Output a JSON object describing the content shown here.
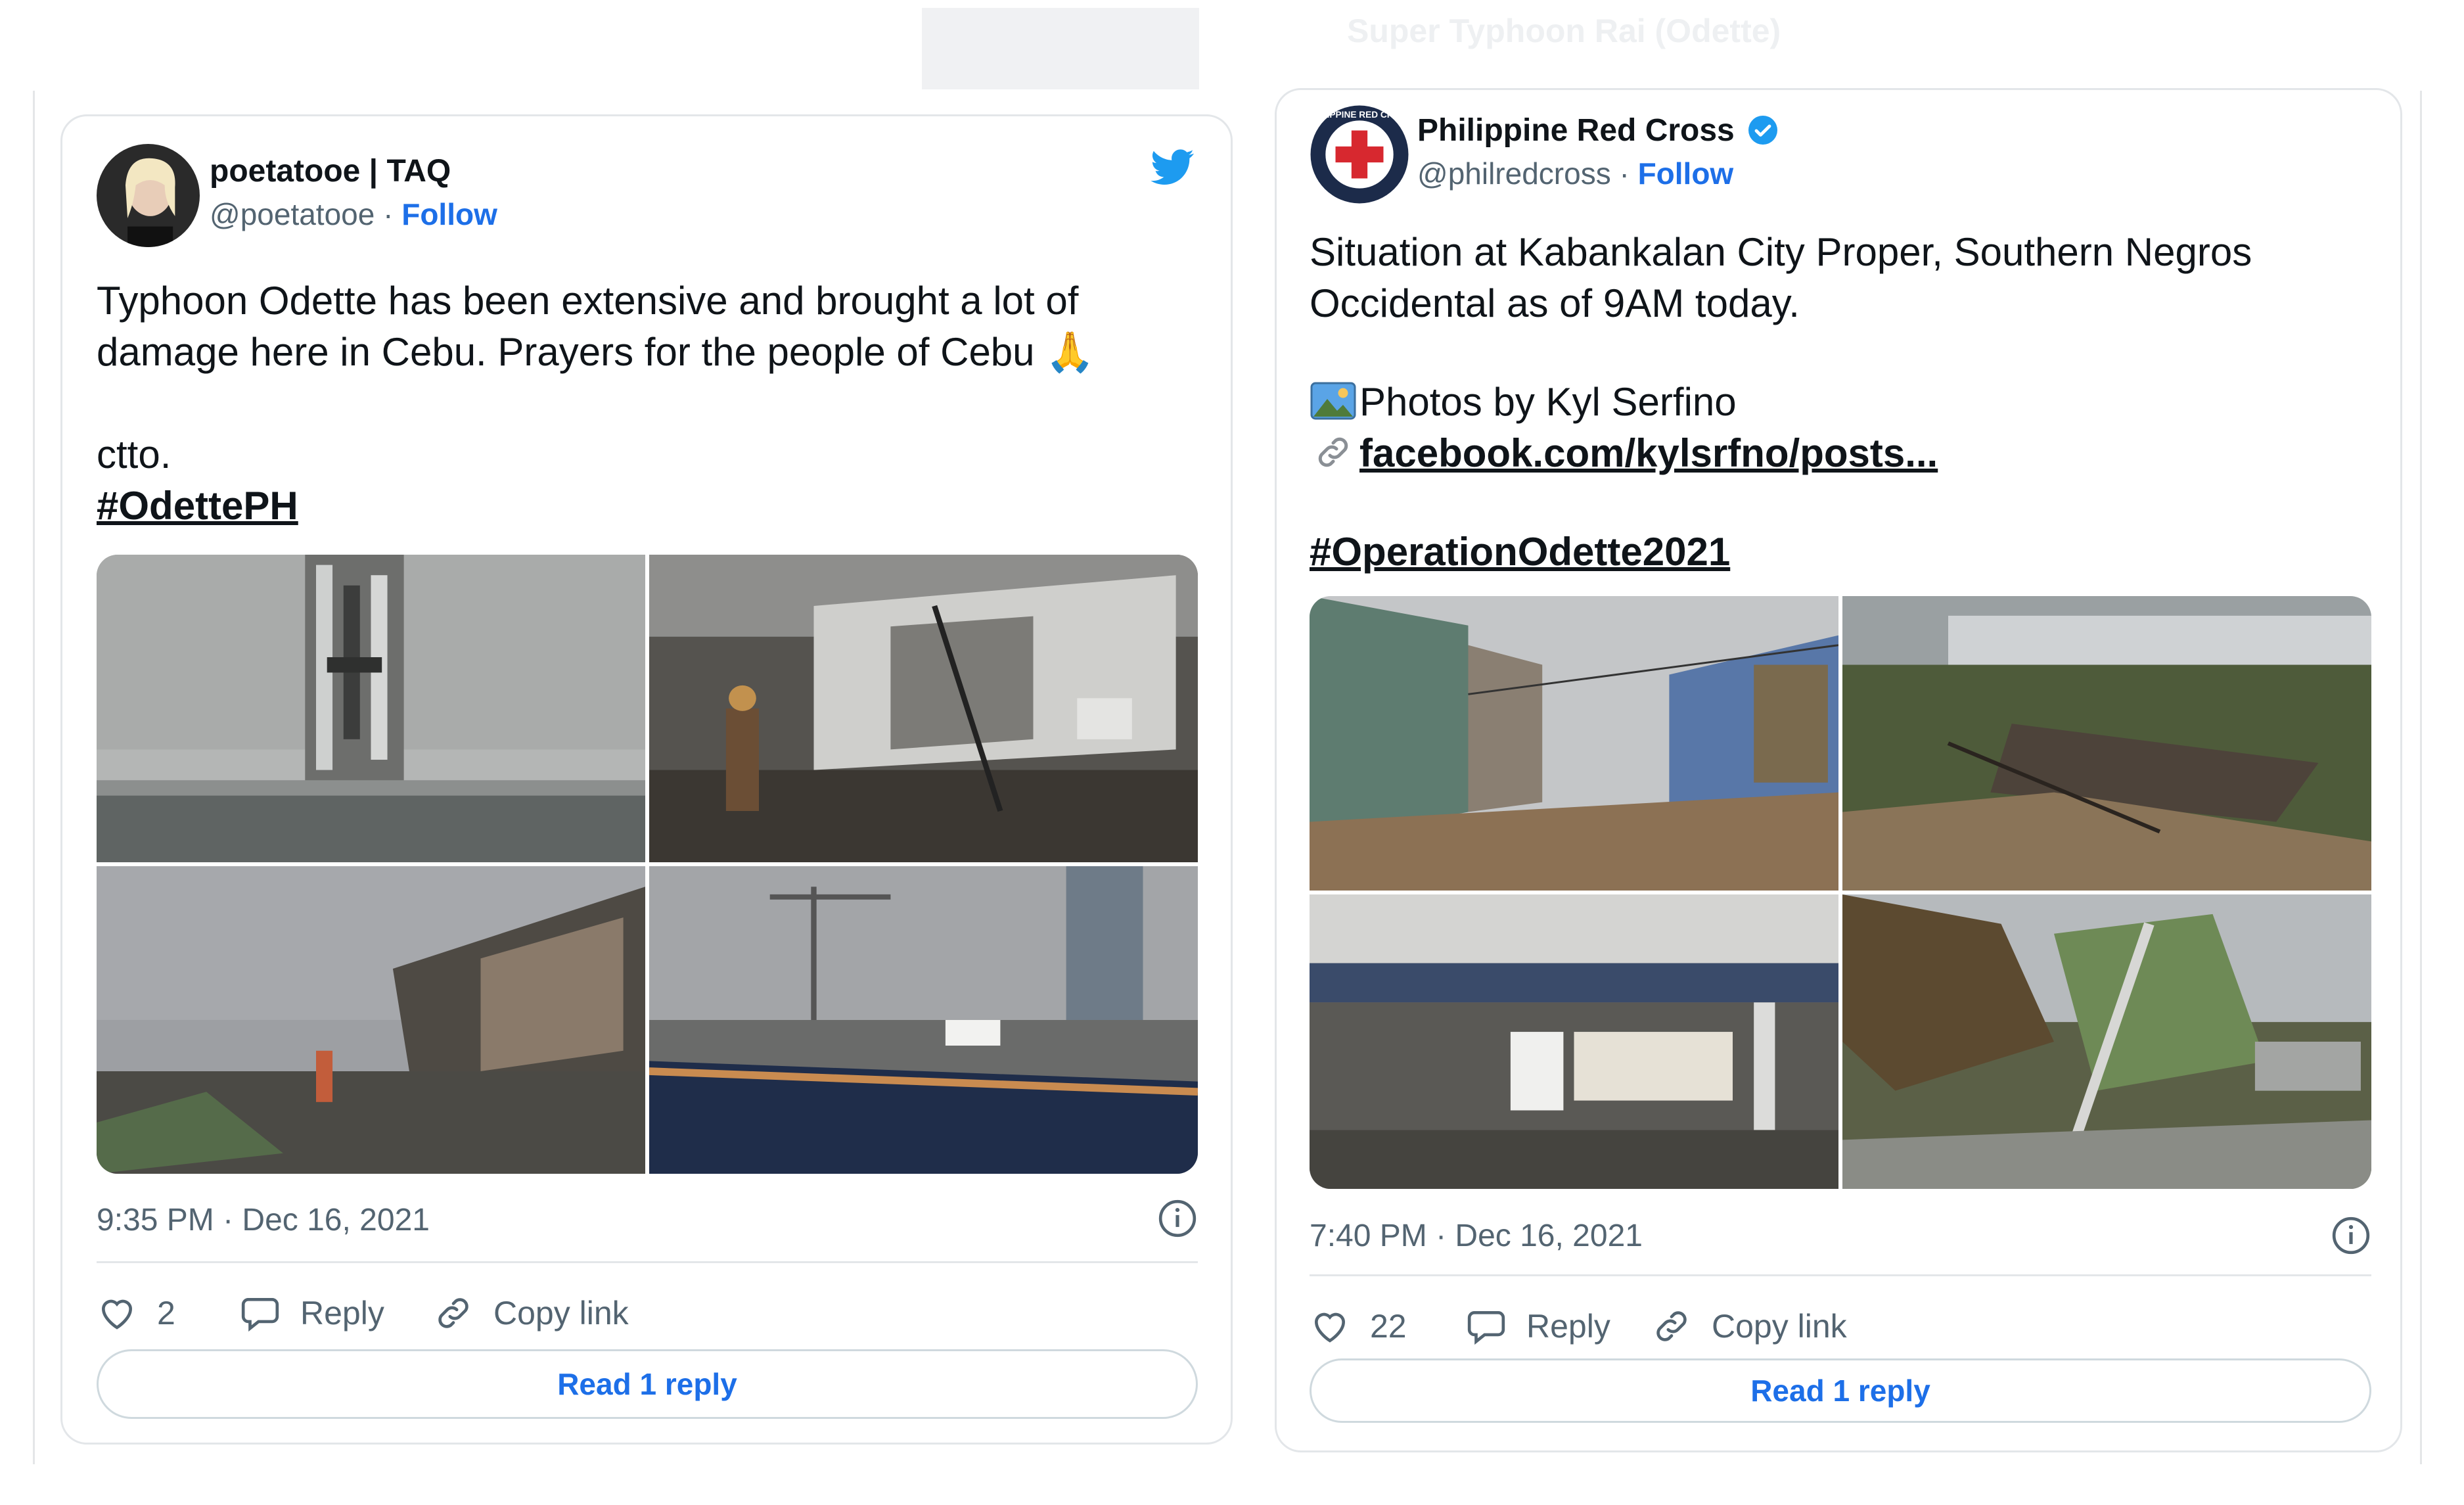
{
  "page": {
    "title": "Super Typhoon Rai (Odette)"
  },
  "tweets": [
    {
      "display_name": "poetatooe | TAQ",
      "handle": "@poetatooe",
      "separator": " · ",
      "follow_label": "Follow",
      "text_line1": "Typhoon Odette has been extensive and brought a lot of",
      "text_line2": "damage here in Cebu. Prayers for the people of Cebu 🙏",
      "text_line3": "ctto.",
      "hashtag": "#OdettePH",
      "timestamp": "9:35 PM · Dec 16, 2021",
      "like_count": "2",
      "reply_label": "Reply",
      "copy_label": "Copy link",
      "read_reply_label": "Read 1 reply",
      "twitter_logo_color": "#1d9bf0"
    },
    {
      "display_name": "Philippine Red Cross",
      "verified": true,
      "handle": "@philredcross",
      "separator": " · ",
      "follow_label": "Follow",
      "text_line1": "Situation at Kabankalan City Proper, Southern Negros",
      "text_line2": "Occidental as of 9AM today.",
      "photos_line": "Photos by Kyl Serfino",
      "link_text": "facebook.com/kylsrfno/posts...",
      "hashtag": "#OperationOdette2021",
      "timestamp": "7:40 PM · Dec 16, 2021",
      "like_count": "22",
      "reply_label": "Reply",
      "copy_label": "Copy link",
      "read_reply_label": "Read 1 reply",
      "avatar_ring_text": "PHILIPPINE RED CROSS"
    }
  ],
  "colors": {
    "link": "#1d6fe8",
    "secondary_text": "#536471",
    "border": "#e3e6e9",
    "verified": "#1d9bf0",
    "red_cross": "#d7282f"
  }
}
